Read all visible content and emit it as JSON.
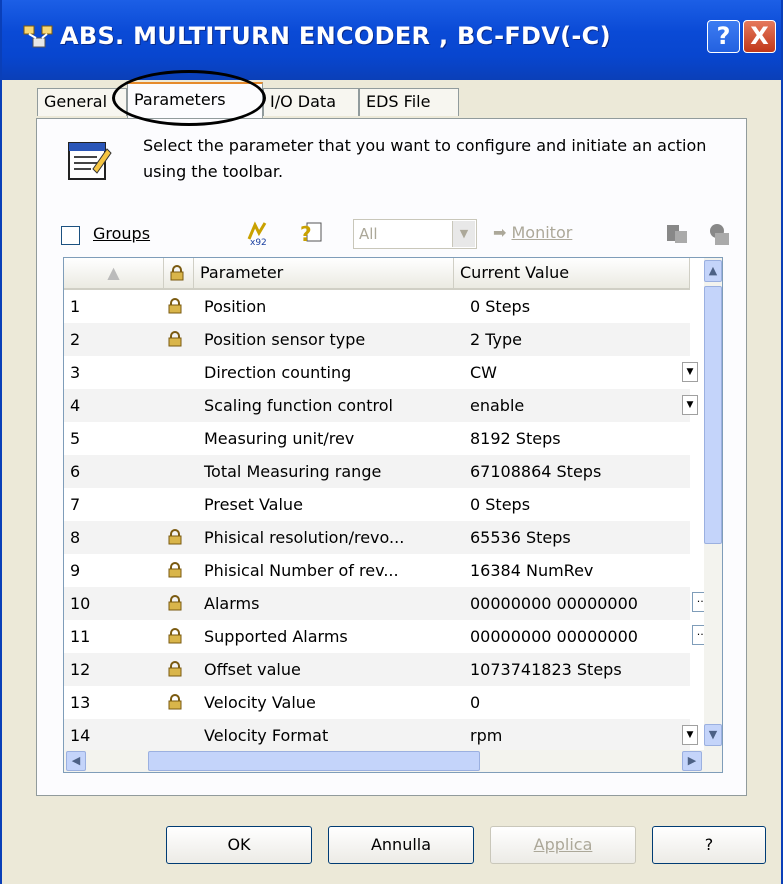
{
  "window": {
    "title": "ABS. MULTITURN ENCODER , BC-FDV(-C)",
    "help_label": "?",
    "close_label": "X"
  },
  "tabs": [
    {
      "label": "General"
    },
    {
      "label": "Parameters"
    },
    {
      "label": "I/O Data"
    },
    {
      "label": "EDS File"
    }
  ],
  "description": "Select the parameter that you want to configure and initiate an action using the toolbar.",
  "toolbar": {
    "groups_label": "Groups",
    "filter_value": "All",
    "monitor_label": "Monitor"
  },
  "grid": {
    "columns": [
      "Parameter",
      "Current Value"
    ],
    "rows": [
      {
        "num": "1",
        "locked": true,
        "name": "Position",
        "value": "0 Steps",
        "control": ""
      },
      {
        "num": "2",
        "locked": true,
        "name": "Position sensor type",
        "value": "2 Type",
        "control": ""
      },
      {
        "num": "3",
        "locked": false,
        "name": "Direction counting",
        "value": "CW",
        "control": "dropdown"
      },
      {
        "num": "4",
        "locked": false,
        "name": "Scaling function control",
        "value": "enable",
        "control": "dropdown"
      },
      {
        "num": "5",
        "locked": false,
        "name": "Measuring unit/rev",
        "value": "8192 Steps",
        "control": ""
      },
      {
        "num": "6",
        "locked": false,
        "name": "Total Measuring range",
        "value": "67108864 Steps",
        "control": ""
      },
      {
        "num": "7",
        "locked": false,
        "name": "Preset Value",
        "value": "0 Steps",
        "control": ""
      },
      {
        "num": "8",
        "locked": true,
        "name": "Phisical resolution/revo...",
        "value": "65536 Steps",
        "control": ""
      },
      {
        "num": "9",
        "locked": true,
        "name": "Phisical Number of rev...",
        "value": "16384 NumRev",
        "control": ""
      },
      {
        "num": "10",
        "locked": true,
        "name": "Alarms",
        "value": "00000000 00000000",
        "control": "dots"
      },
      {
        "num": "11",
        "locked": true,
        "name": "Supported Alarms",
        "value": "00000000 00000000",
        "control": "dots"
      },
      {
        "num": "12",
        "locked": true,
        "name": "Offset value",
        "value": "1073741823 Steps",
        "control": ""
      },
      {
        "num": "13",
        "locked": true,
        "name": "Velocity Value",
        "value": "0",
        "control": ""
      },
      {
        "num": "14",
        "locked": false,
        "name": "Velocity Format",
        "value": "rpm",
        "control": "dropdown"
      }
    ]
  },
  "buttons": {
    "ok": "OK",
    "cancel": "Annulla",
    "apply": "Applica",
    "help": "?"
  }
}
